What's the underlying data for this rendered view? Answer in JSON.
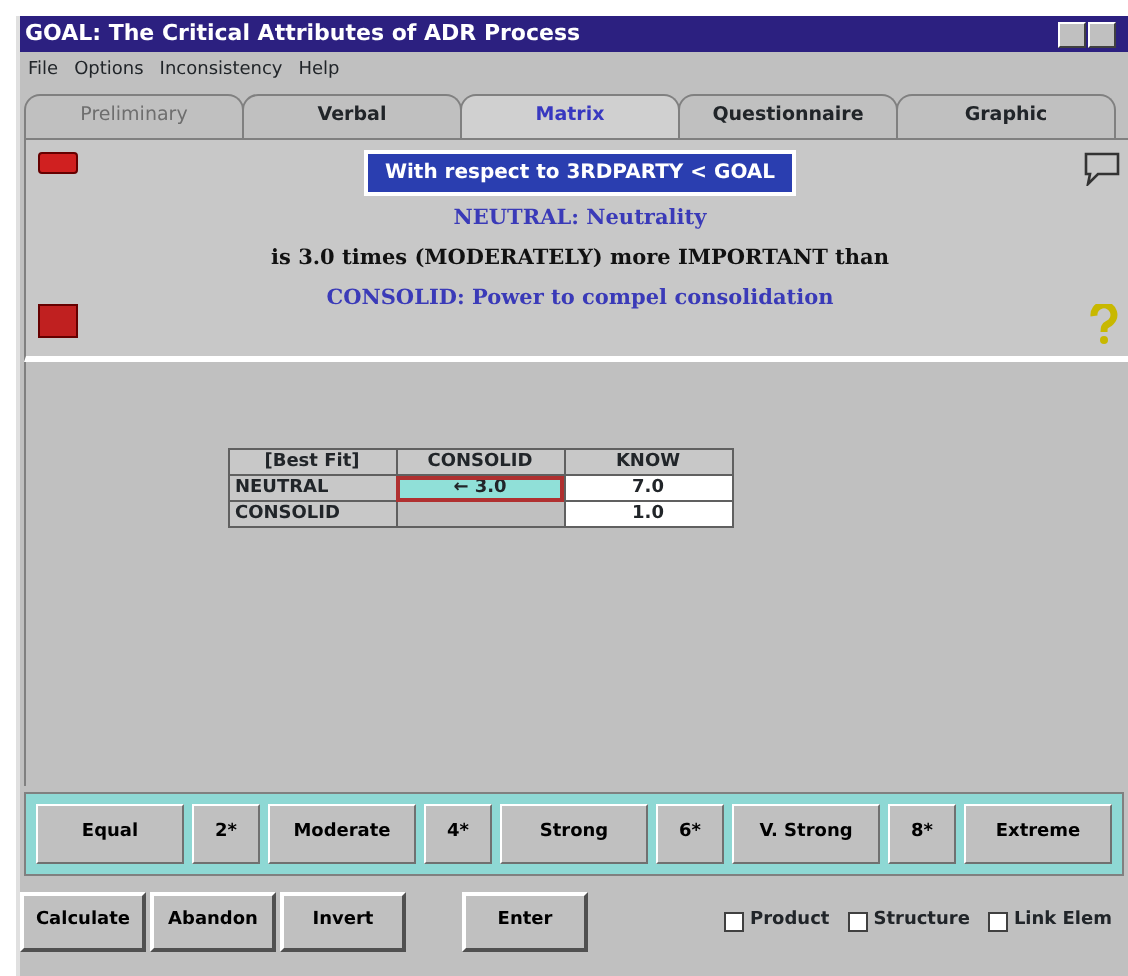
{
  "window": {
    "title": "GOAL: The Critical Attributes of ADR Process"
  },
  "menu": [
    "File",
    "Options",
    "Inconsistency",
    "Help"
  ],
  "tabs": [
    {
      "label": "Preliminary",
      "selected": false,
      "disabled": true
    },
    {
      "label": "Verbal",
      "selected": false,
      "disabled": false
    },
    {
      "label": "Matrix",
      "selected": true,
      "disabled": false
    },
    {
      "label": "Questionnaire",
      "selected": false,
      "disabled": false
    },
    {
      "label": "Graphic",
      "selected": false,
      "disabled": false
    }
  ],
  "statement": {
    "context": "With respect to 3RDPARTY < GOAL",
    "first": "NEUTRAL: Neutrality",
    "relation": "is 3.0 times (MODERATELY) more IMPORTANT than",
    "second": "CONSOLID: Power to compel consolidation"
  },
  "matrix": {
    "columns": [
      "[Best Fit]",
      "CONSOLID",
      "KNOW"
    ],
    "rows": [
      {
        "cells": [
          {
            "kind": "label",
            "text": "NEUTRAL"
          },
          {
            "kind": "value",
            "text": "← 3.0",
            "selected": true
          },
          {
            "kind": "value",
            "text": "7.0",
            "selected": false
          }
        ]
      },
      {
        "cells": [
          {
            "kind": "label",
            "text": "CONSOLID"
          },
          {
            "kind": "blank"
          },
          {
            "kind": "value",
            "text": "1.0",
            "selected": false
          }
        ]
      }
    ]
  },
  "scale": [
    "Equal",
    "2*",
    "Moderate",
    "4*",
    "Strong",
    "6*",
    "V. Strong",
    "8*",
    "Extreme"
  ],
  "actions": [
    "Calculate",
    "Abandon",
    "Invert"
  ],
  "enter": "Enter",
  "options": [
    {
      "label": "Product",
      "checked": false
    },
    {
      "label": "Structure",
      "checked": false
    },
    {
      "label": "Link Elem",
      "checked": false
    }
  ]
}
